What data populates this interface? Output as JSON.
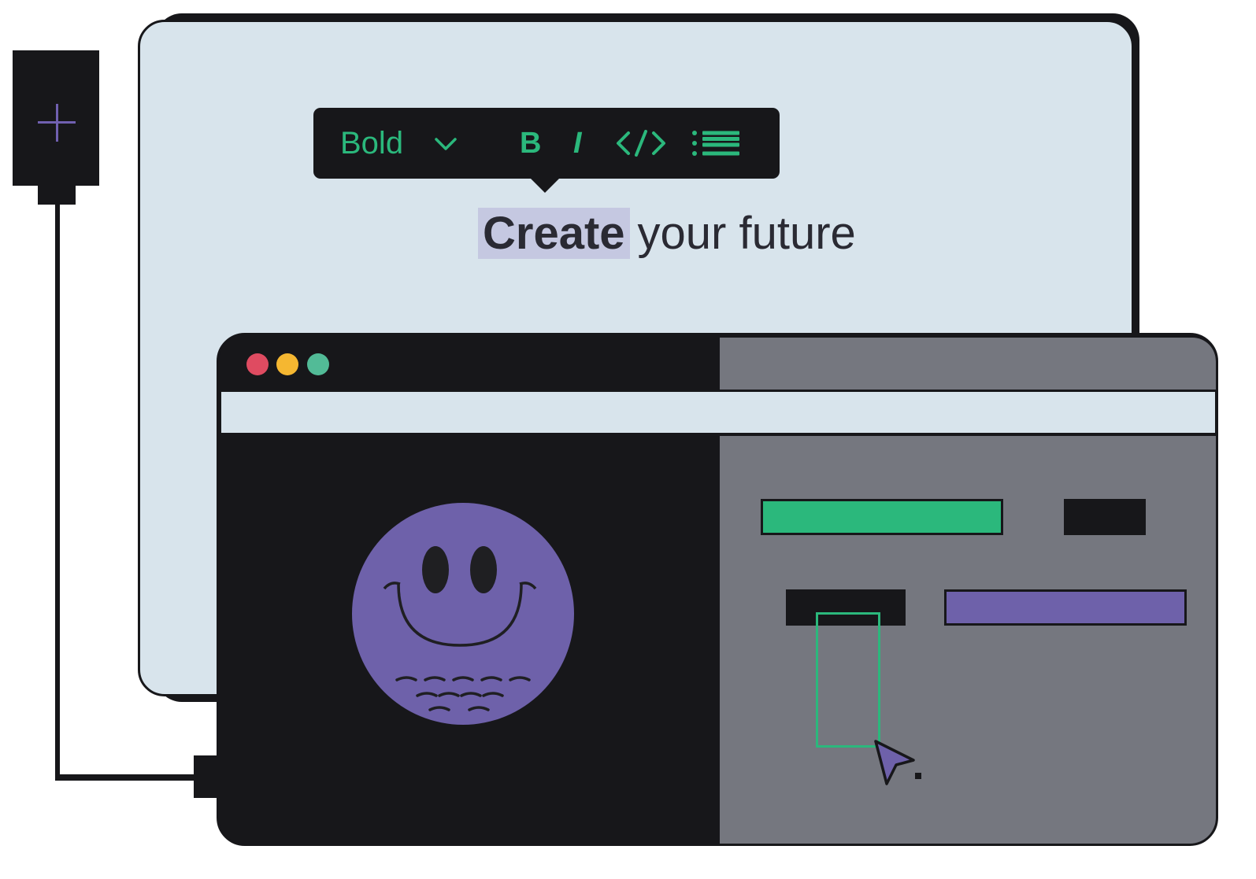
{
  "toolbar": {
    "style_label": "Bold",
    "bold_label": "B",
    "italic_label": "I"
  },
  "editor": {
    "selected_text": "Create",
    "rest_text": "your future"
  },
  "colors": {
    "accent_green": "#2bb87c",
    "accent_purple": "#6e61aa",
    "dark": "#17171a",
    "panel_light": "#d8e4ec",
    "panel_gray": "#75777f",
    "dot_red": "#df4b61",
    "dot_yellow": "#f5b731",
    "dot_green": "#52bb97"
  },
  "icons": {
    "add": "plus-icon",
    "dropdown": "chevron-down-icon",
    "code": "code-icon",
    "list": "bulleted-list-icon",
    "pointer": "cursor-arrow-icon",
    "avatar": "smiley-face-icon"
  }
}
